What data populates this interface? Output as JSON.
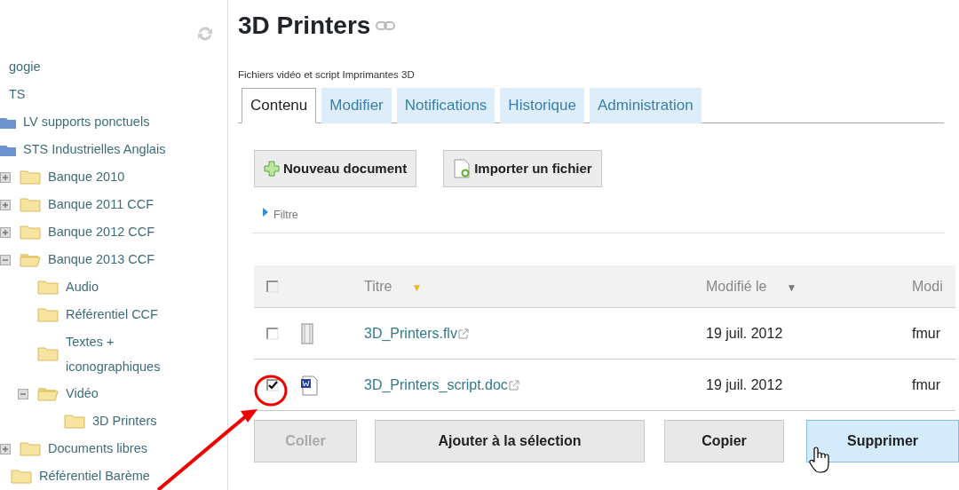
{
  "sidebar": {
    "tree": [
      {
        "label": "gogie"
      },
      {
        "label": "TS",
        "children": [
          {
            "label": "LV supports ponctuels",
            "kind": "blue-folder"
          },
          {
            "label": "STS Industrielles Anglais",
            "kind": "blue-folder",
            "children": [
              {
                "label": "Banque 2010",
                "kind": "folder",
                "expanded": false
              },
              {
                "label": "Banque 2011 CCF",
                "kind": "folder",
                "expanded": false
              },
              {
                "label": "Banque 2012 CCF",
                "kind": "folder",
                "expanded": false
              },
              {
                "label": "Banque 2013 CCF",
                "kind": "folder",
                "expanded": true,
                "children": [
                  {
                    "label": "Audio",
                    "kind": "folder"
                  },
                  {
                    "label": "Référentiel CCF",
                    "kind": "folder"
                  },
                  {
                    "label": "Textes + iconographiques",
                    "kind": "folder"
                  },
                  {
                    "label": "Vidéo",
                    "kind": "folder",
                    "expanded": true,
                    "children": [
                      {
                        "label": "3D Printers",
                        "kind": "folder"
                      }
                    ]
                  }
                ]
              },
              {
                "label": "Documents libres",
                "kind": "folder",
                "expanded": false
              },
              {
                "label": "Référentiel Barème",
                "kind": "folder"
              }
            ]
          }
        ]
      }
    ]
  },
  "page": {
    "title": "3D Printers",
    "description": "Fichiers vidéo et script Imprimantes 3D"
  },
  "tabs": [
    {
      "label": "Contenu",
      "selected": true
    },
    {
      "label": "Modifier",
      "selected": false
    },
    {
      "label": "Notifications",
      "selected": false
    },
    {
      "label": "Historique",
      "selected": false
    },
    {
      "label": "Administration",
      "selected": false
    }
  ],
  "toolbar": [
    {
      "label": "Nouveau document",
      "kind": "new"
    },
    {
      "label": "Importer un fichier",
      "kind": "import"
    }
  ],
  "filter": {
    "label": "Filtre",
    "expanded": false
  },
  "table": {
    "all_checked": false,
    "columns": [
      {
        "label": "Titre",
        "sort_mark": "▼",
        "sorted": true
      },
      {
        "label": "Modifié le",
        "sort_mark": "▼",
        "sorted": false
      },
      {
        "label": "Modi"
      }
    ],
    "rows": [
      {
        "checked": false,
        "kind": "video",
        "title": "3D_Printers.flv",
        "modified": "19 juil. 2012",
        "column_3": "fmur"
      },
      {
        "checked": true,
        "kind": "word",
        "title": "3D_Printers_script.doc",
        "modified": "19 juil. 2012",
        "column_3": "fmur"
      }
    ]
  },
  "actions": [
    {
      "label": "Coller",
      "disabled": true,
      "hovered": false
    },
    {
      "label": "Ajouter à la sélection",
      "disabled": false,
      "hovered": false
    },
    {
      "label": "Copier",
      "disabled": false,
      "hovered": false
    },
    {
      "label": "Supprimer",
      "disabled": false,
      "hovered": true
    }
  ]
}
